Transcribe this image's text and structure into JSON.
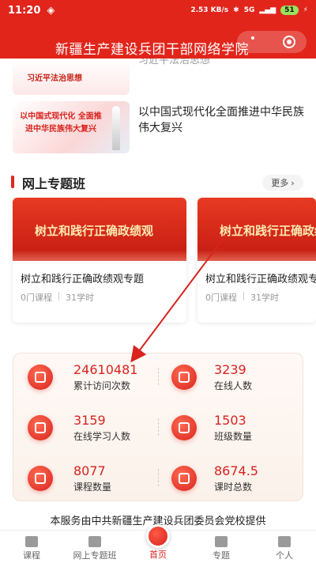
{
  "status_bar": {
    "time": "11:20",
    "speed": "2.53 KB/s",
    "network": "5G",
    "battery": "51"
  },
  "header": {
    "title": "新疆生产建设兵团干部网络学院"
  },
  "news": [
    {
      "thumb_text": "习近平法治思想",
      "title": "习近平法治思想"
    },
    {
      "thumb_text": "以中国式现代化 全面推进中华民族伟大复兴",
      "title": "以中国式现代化全面推进中华民族伟大复兴"
    }
  ],
  "section": {
    "title": "网上专题班",
    "more_label": "更多"
  },
  "courses": [
    {
      "banner": "树立和践行正确政绩观",
      "name": "树立和践行正确政绩观专题",
      "courses": "0门课程",
      "hours": "31学时"
    },
    {
      "banner": "树立和践行正确政绩观",
      "name": "树立和践行正确政绩观专题",
      "courses": "0门课程",
      "hours": "31学时"
    }
  ],
  "stats": [
    {
      "value": "24610481",
      "label": "累计访问次数",
      "icon": "visitors-icon"
    },
    {
      "value": "3239",
      "label": "在线人数",
      "icon": "monitor-icon"
    },
    {
      "value": "3159",
      "label": "在线学习人数",
      "icon": "learner-icon"
    },
    {
      "value": "1503",
      "label": "班级数量",
      "icon": "class-icon"
    },
    {
      "value": "8077",
      "label": "课程数量",
      "icon": "course-icon"
    },
    {
      "value": "8674.5",
      "label": "课时总数",
      "icon": "calendar-icon"
    }
  ],
  "footer": {
    "text": "本服务由中共新疆生产建设兵团委员会党校提供"
  },
  "tabs": [
    {
      "label": "课程",
      "icon": "course-tab-icon"
    },
    {
      "label": "网上专题班",
      "icon": "class-tab-icon"
    },
    {
      "label": "首页",
      "icon": "home-tab-icon"
    },
    {
      "label": "专题",
      "icon": "topic-tab-icon"
    },
    {
      "label": "个人",
      "icon": "person-tab-icon"
    }
  ],
  "colors": {
    "brand": "#e1251b",
    "accent_text": "#d8231e"
  }
}
